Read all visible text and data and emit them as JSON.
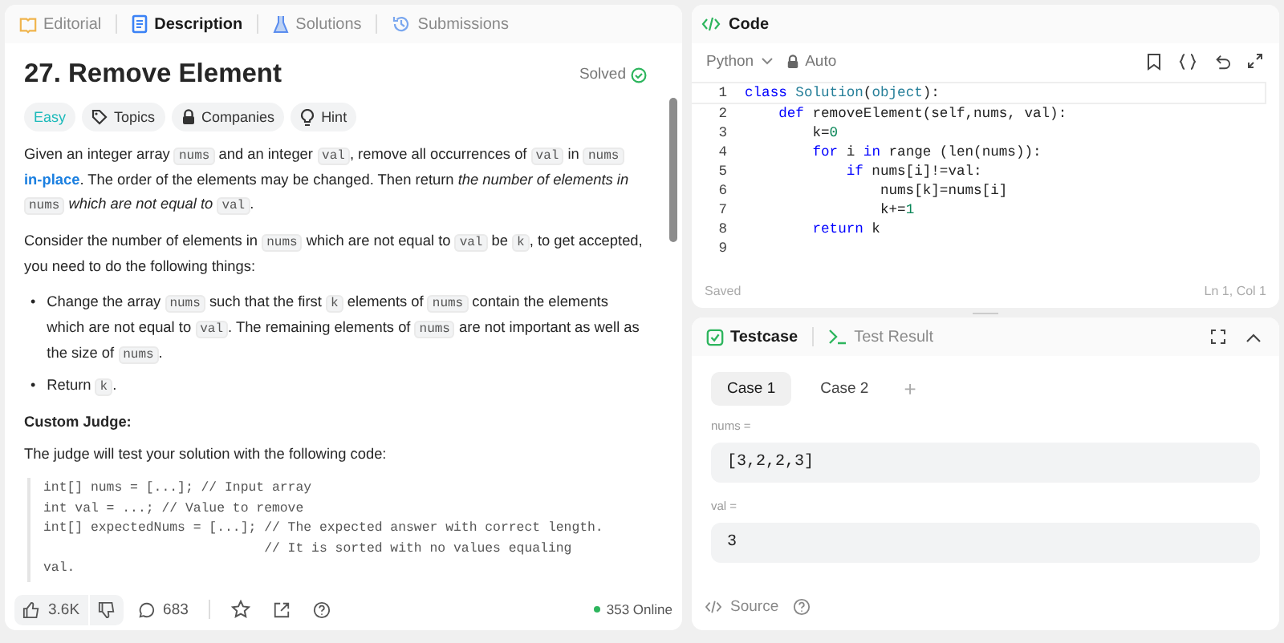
{
  "left_tabs": [
    {
      "label": "Editorial",
      "selected": false
    },
    {
      "label": "Description",
      "selected": true
    },
    {
      "label": "Solutions",
      "selected": false
    },
    {
      "label": "Submissions",
      "selected": false
    }
  ],
  "problem": {
    "title": "27. Remove Element",
    "status": "Solved",
    "solved": true,
    "difficulty": "Easy",
    "tags": [
      {
        "label": "Topics"
      },
      {
        "label": "Companies"
      },
      {
        "label": "Hint"
      }
    ]
  },
  "description": [
    {
      "kind": "p",
      "segments": [
        {
          "kind": "text",
          "text": "Given an integer array "
        },
        {
          "kind": "code",
          "text": "nums"
        },
        {
          "kind": "text",
          "text": " and an integer "
        },
        {
          "kind": "code",
          "text": "val"
        },
        {
          "kind": "text",
          "text": ", remove all occurrences of "
        },
        {
          "kind": "code",
          "text": "val"
        },
        {
          "kind": "text",
          "text": " in "
        },
        {
          "kind": "code",
          "text": "nums"
        },
        {
          "kind": "link",
          "text": " in-place"
        },
        {
          "kind": "text",
          "text": ". The order of the elements may be changed. Then return "
        },
        {
          "kind": "italic",
          "text": "the number of elements in "
        },
        {
          "kind": "code",
          "text": "nums"
        },
        {
          "kind": "italic",
          "text": " which are not equal to "
        },
        {
          "kind": "code",
          "text": "val"
        },
        {
          "kind": "text",
          "text": "."
        }
      ]
    },
    {
      "kind": "p",
      "segments": [
        {
          "kind": "text",
          "text": "Consider the number of elements in "
        },
        {
          "kind": "code",
          "text": "nums"
        },
        {
          "kind": "text",
          "text": " which are not equal to "
        },
        {
          "kind": "code",
          "text": "val"
        },
        {
          "kind": "text",
          "text": " be "
        },
        {
          "kind": "code",
          "text": "k"
        },
        {
          "kind": "text",
          "text": ", to get accepted, you need to do the following things:"
        }
      ]
    },
    {
      "kind": "bullets",
      "marker": "•",
      "items": [
        [
          {
            "kind": "text",
            "text": "Change the array "
          },
          {
            "kind": "code",
            "text": "nums"
          },
          {
            "kind": "text",
            "text": " such that the first "
          },
          {
            "kind": "code",
            "text": "k"
          },
          {
            "kind": "text",
            "text": " elements of "
          },
          {
            "kind": "code",
            "text": "nums"
          },
          {
            "kind": "text",
            "text": " contain the elements which are not equal to "
          },
          {
            "kind": "code",
            "text": "val"
          },
          {
            "kind": "text",
            "text": ". The remaining elements of "
          },
          {
            "kind": "code",
            "text": "nums"
          },
          {
            "kind": "text",
            "text": " are not important as well as the size of "
          },
          {
            "kind": "code",
            "text": "nums"
          },
          {
            "kind": "text",
            "text": "."
          }
        ],
        [
          {
            "kind": "text",
            "text": "Return "
          },
          {
            "kind": "code",
            "text": "k"
          },
          {
            "kind": "text",
            "text": "."
          }
        ]
      ]
    },
    {
      "kind": "heading",
      "text": "Custom Judge:"
    },
    {
      "kind": "p",
      "segments": [
        {
          "kind": "text",
          "text": "The judge will test your solution with the following code:"
        }
      ]
    },
    {
      "kind": "code",
      "lines": [
        "int[] nums = [...]; // Input array",
        "int val = ...; // Value to remove",
        "int[] expectedNums = [...]; // The expected answer with correct length.",
        "                            // It is sorted with no values equaling",
        "val."
      ]
    }
  ],
  "footer": {
    "likes": "3.6K",
    "comments": "683",
    "online": "353 Online"
  },
  "editor": {
    "title": "Code",
    "language": "Python",
    "mode": "Auto",
    "status": "Saved",
    "cursor": "Ln 1, Col 1",
    "lines": [
      {
        "number": "1",
        "tokens": [
          {
            "kind": "kw",
            "text": "class"
          },
          {
            "kind": "type",
            "text": " Solution"
          },
          {
            "kind": "plain",
            "text": "("
          },
          {
            "kind": "type",
            "text": "object"
          },
          {
            "kind": "plain",
            "text": "):"
          }
        ]
      },
      {
        "number": "2",
        "tokens": [
          {
            "kind": "kw",
            "text": "    def"
          },
          {
            "kind": "plain",
            "text": " removeElement(self,nums, val):"
          }
        ]
      },
      {
        "number": "3",
        "tokens": [
          {
            "kind": "plain",
            "text": "        k="
          },
          {
            "kind": "num",
            "text": "0"
          }
        ]
      },
      {
        "number": "4",
        "tokens": [
          {
            "kind": "kw",
            "text": "        for"
          },
          {
            "kind": "plain",
            "text": " i "
          },
          {
            "kind": "kw",
            "text": "in"
          },
          {
            "kind": "plain",
            "text": " range (len(nums)):"
          }
        ]
      },
      {
        "number": "5",
        "tokens": [
          {
            "kind": "kw",
            "text": "            if"
          },
          {
            "kind": "plain",
            "text": " nums[i]!=val:"
          }
        ]
      },
      {
        "number": "6",
        "tokens": [
          {
            "kind": "plain",
            "text": "                nums[k]=nums[i]"
          }
        ]
      },
      {
        "number": "7",
        "tokens": [
          {
            "kind": "plain",
            "text": "                k+="
          },
          {
            "kind": "num",
            "text": "1"
          }
        ]
      },
      {
        "number": "8",
        "tokens": [
          {
            "kind": "kw",
            "text": "        return"
          },
          {
            "kind": "plain",
            "text": " k"
          }
        ]
      },
      {
        "number": "9"
      }
    ]
  },
  "testcase": {
    "tabs": [
      {
        "label": "Testcase",
        "selected": true
      },
      {
        "label": "Test Result",
        "selected": false
      }
    ],
    "cases": [
      {
        "label": "Case 1",
        "selected": true
      },
      {
        "label": "Case 2",
        "selected": false
      }
    ],
    "add": "+",
    "inputs": [
      {
        "label": "nums =",
        "value": "[3,2,2,3]"
      },
      {
        "label": "val =",
        "value": "3"
      }
    ],
    "source": "Source"
  }
}
